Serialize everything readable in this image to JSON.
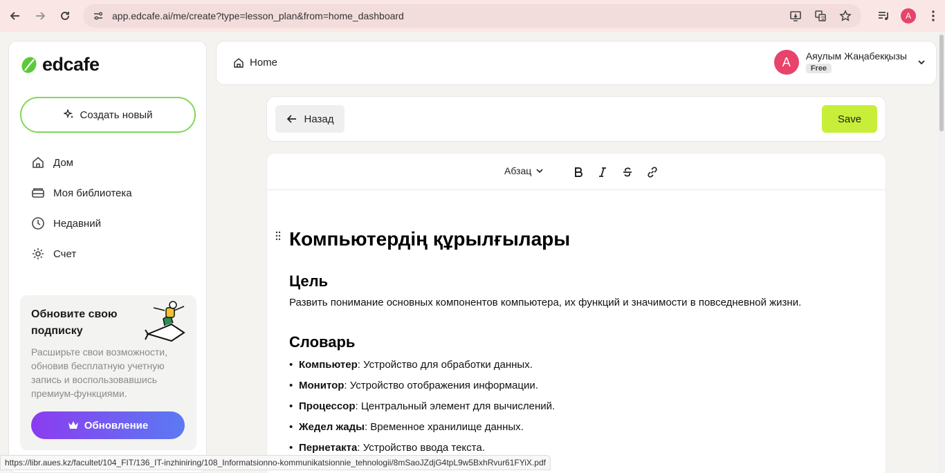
{
  "browser": {
    "url": "app.edcafe.ai/me/create?type=lesson_plan&from=home_dashboard",
    "profile_initial": "A",
    "status_url": "https://libr.aues.kz/facultet/104_FIT/136_IT-inzhiniring/108_Informatsionno-kommunikatsionnie_tehnologii/8mSaoJZdjG4tpL9w5BxhRvur61FYiX.pdf"
  },
  "sidebar": {
    "logo_text": "edcafe",
    "create_label": "Создать новый",
    "items": [
      {
        "label": "Дом",
        "icon": "home-icon"
      },
      {
        "label": "Моя библиотека",
        "icon": "library-icon"
      },
      {
        "label": "Недавний",
        "icon": "clock-icon"
      },
      {
        "label": "Счет",
        "icon": "gear-icon"
      }
    ],
    "promo": {
      "title": "Обновите свою подписку",
      "text": "Расширьте свои возможности, обновив бесплатную учетную запись и воспользовавшись премиум-функциями.",
      "button": "Обновление"
    }
  },
  "header": {
    "breadcrumb": "Home",
    "user_name": "Аяулым Жаңабекқызы",
    "user_initial": "A",
    "plan": "Free"
  },
  "toolbar": {
    "back_label": "Назад",
    "save_label": "Save"
  },
  "editor": {
    "paragraph_style": "Абзац",
    "title": "Компьютердің құрылғылары",
    "goal_heading": "Цель",
    "goal_text": "Развить понимание основных компонентов компьютера, их функций и значимости в повседневной жизни.",
    "vocab_heading": "Словарь",
    "vocab": [
      {
        "term": "Компьютер",
        "def": ": Устройство для обработки данных."
      },
      {
        "term": "Монитор",
        "def": ": Устройство отображения информации."
      },
      {
        "term": "Процессор",
        "def": ": Центральный элемент для вычислений."
      },
      {
        "term": "Жедел жады",
        "def": ": Временное хранилище данных."
      },
      {
        "term": "Пернетакта",
        "def": ": Устройство ввода текста."
      }
    ]
  },
  "colors": {
    "accent_green": "#7ed957",
    "save_green": "#c8ee3a",
    "avatar_pink": "#e8436a",
    "upgrade_gradient": [
      "#8b3cf0",
      "#5b7af2"
    ]
  }
}
